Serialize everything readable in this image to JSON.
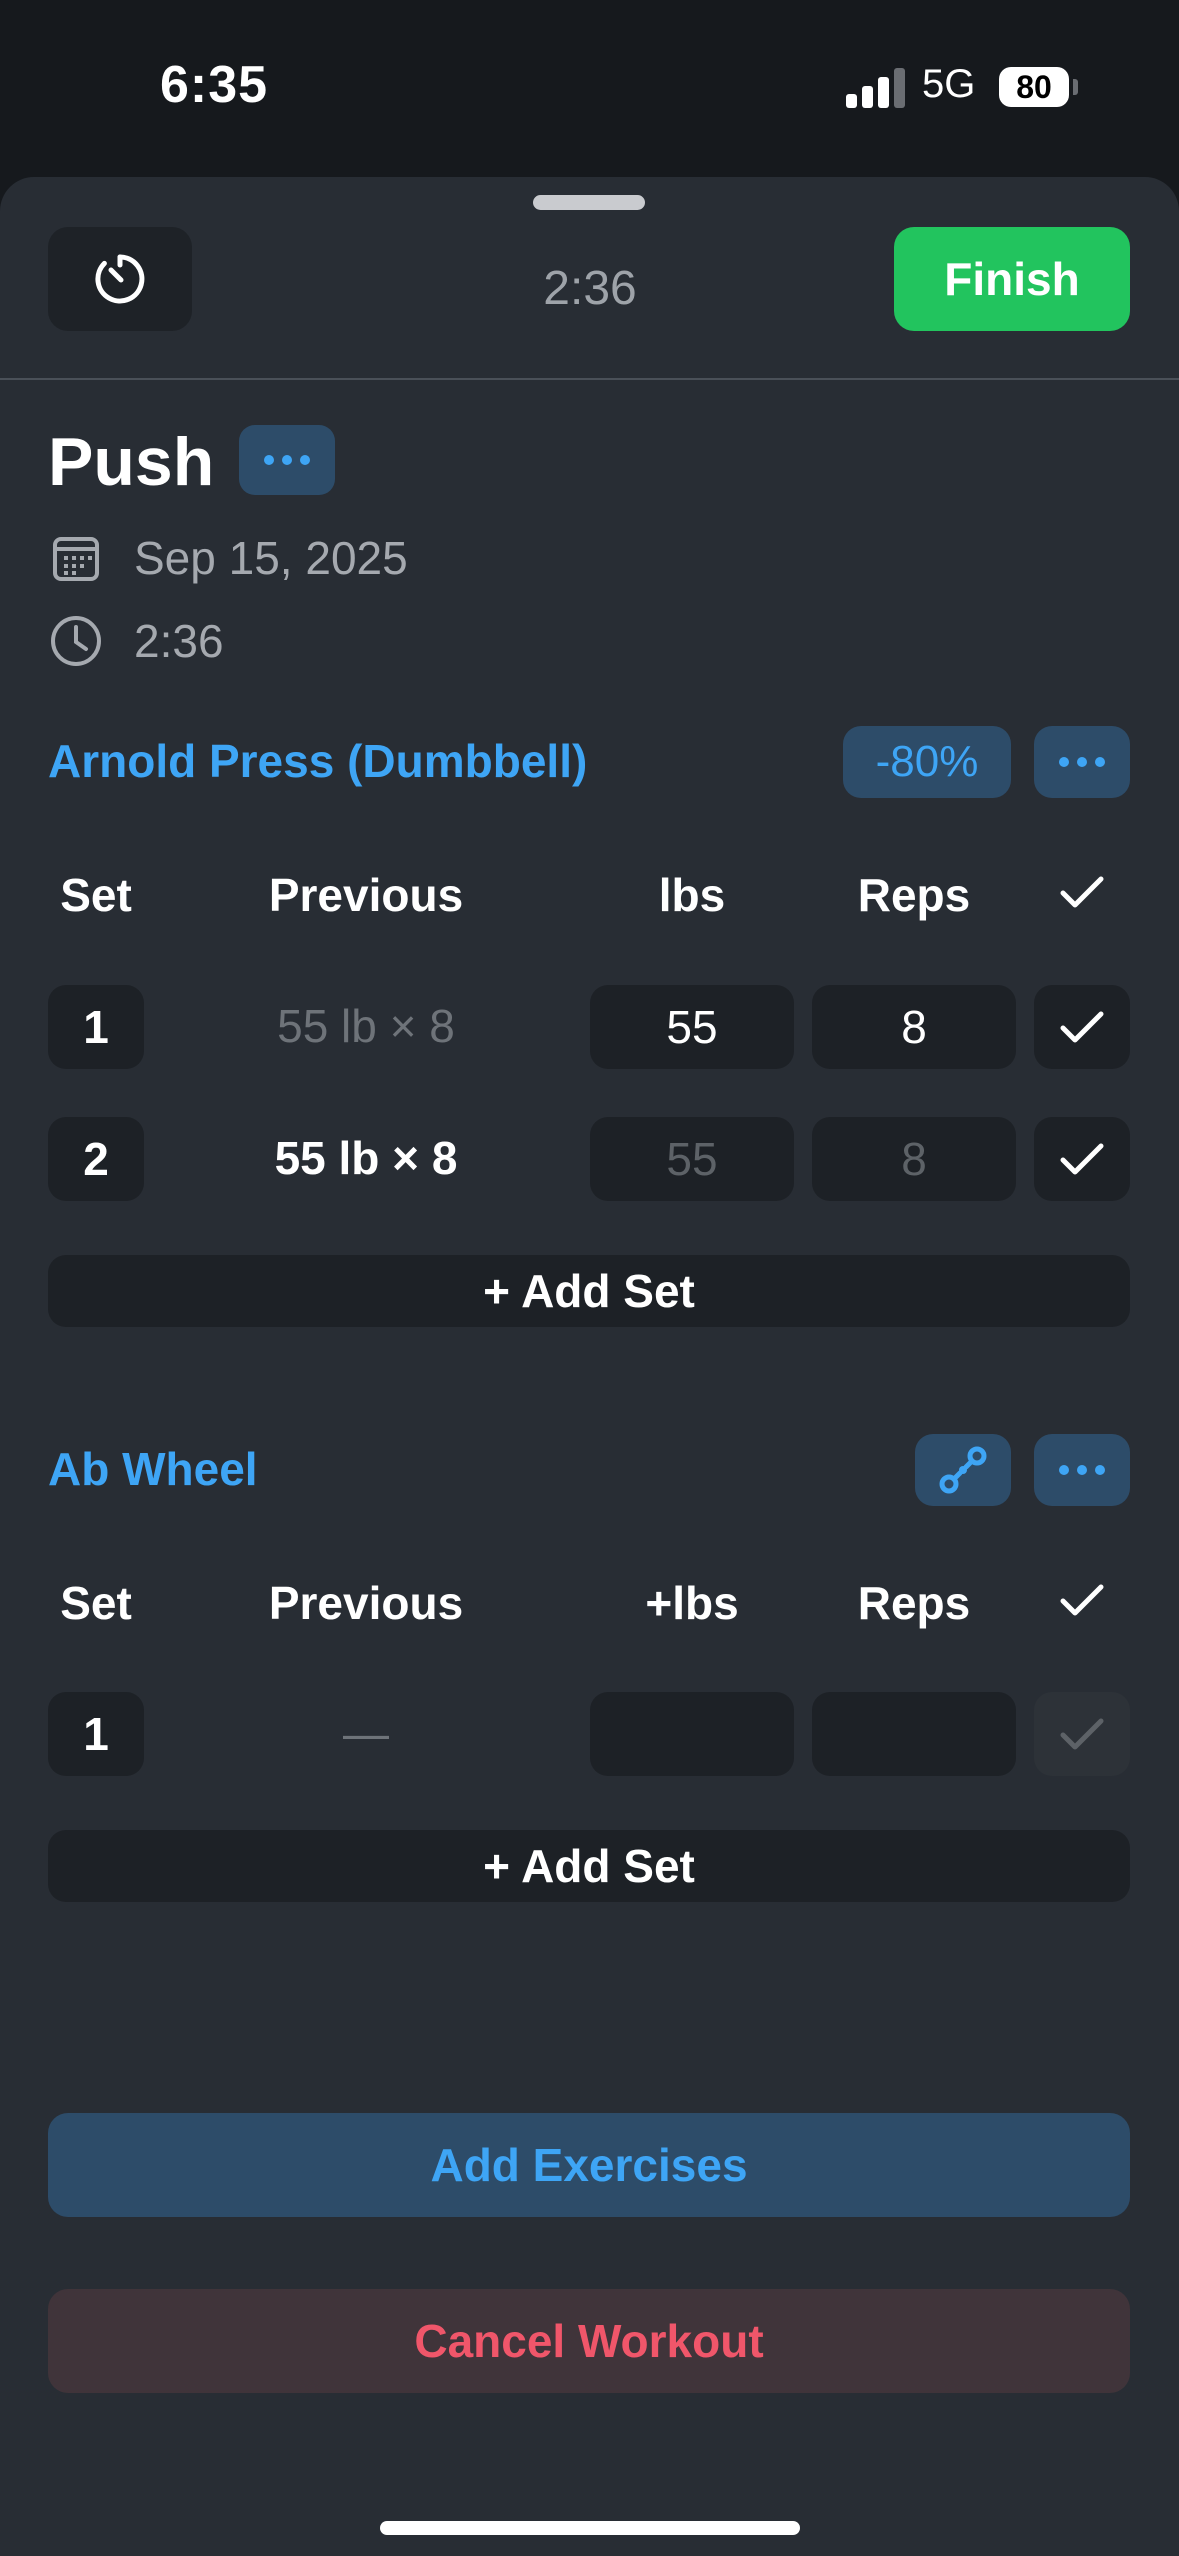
{
  "status_bar": {
    "time": "6:35",
    "network": "5G",
    "battery": "80"
  },
  "header": {
    "timer": "2:36",
    "finish_label": "Finish"
  },
  "workout": {
    "title": "Push",
    "date": "Sep 15, 2025",
    "duration": "2:36"
  },
  "columns": {
    "set": "Set",
    "previous": "Previous",
    "reps": "Reps"
  },
  "exercises": [
    {
      "name": "Arnold Press (Dumbbell)",
      "badge": "-80%",
      "weight_header": "lbs",
      "sets": [
        {
          "set": "1",
          "previous": "55 lb × 8",
          "weight": "55",
          "reps": "8"
        },
        {
          "set": "2",
          "previous": "55 lb × 8",
          "weight": "55",
          "reps": "8"
        }
      ],
      "add_set_label": "+ Add Set"
    },
    {
      "name": "Ab Wheel",
      "weight_header": "+lbs",
      "sets": [
        {
          "set": "1",
          "previous": "—",
          "weight": "",
          "reps": ""
        }
      ],
      "add_set_label": "+ Add Set"
    }
  ],
  "actions": {
    "add_exercises": "Add Exercises",
    "cancel_workout": "Cancel Workout"
  },
  "colors": {
    "accent": "#3ea5f5",
    "finish": "#22c45e",
    "cancel": "#f0566a",
    "sheet": "#282d34"
  }
}
